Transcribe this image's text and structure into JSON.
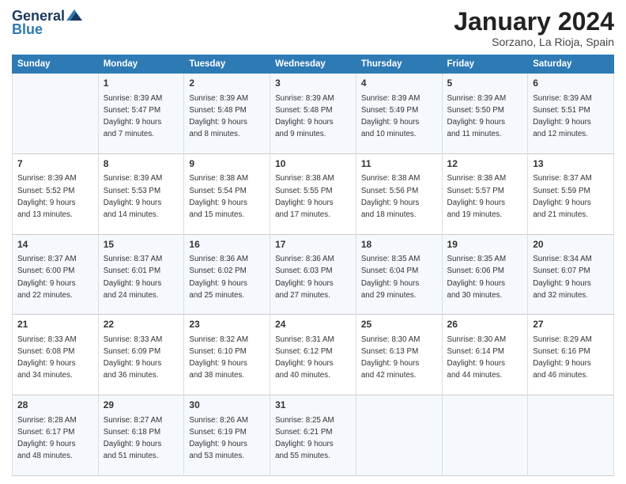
{
  "logo": {
    "line1": "General",
    "line2": "Blue"
  },
  "title": "January 2024",
  "subtitle": "Sorzano, La Rioja, Spain",
  "weekdays": [
    "Sunday",
    "Monday",
    "Tuesday",
    "Wednesday",
    "Thursday",
    "Friday",
    "Saturday"
  ],
  "weeks": [
    [
      {
        "day": null,
        "info": null
      },
      {
        "day": "1",
        "info": "Sunrise: 8:39 AM\nSunset: 5:47 PM\nDaylight: 9 hours\nand 7 minutes."
      },
      {
        "day": "2",
        "info": "Sunrise: 8:39 AM\nSunset: 5:48 PM\nDaylight: 9 hours\nand 8 minutes."
      },
      {
        "day": "3",
        "info": "Sunrise: 8:39 AM\nSunset: 5:48 PM\nDaylight: 9 hours\nand 9 minutes."
      },
      {
        "day": "4",
        "info": "Sunrise: 8:39 AM\nSunset: 5:49 PM\nDaylight: 9 hours\nand 10 minutes."
      },
      {
        "day": "5",
        "info": "Sunrise: 8:39 AM\nSunset: 5:50 PM\nDaylight: 9 hours\nand 11 minutes."
      },
      {
        "day": "6",
        "info": "Sunrise: 8:39 AM\nSunset: 5:51 PM\nDaylight: 9 hours\nand 12 minutes."
      }
    ],
    [
      {
        "day": "7",
        "info": "Sunrise: 8:39 AM\nSunset: 5:52 PM\nDaylight: 9 hours\nand 13 minutes."
      },
      {
        "day": "8",
        "info": "Sunrise: 8:39 AM\nSunset: 5:53 PM\nDaylight: 9 hours\nand 14 minutes."
      },
      {
        "day": "9",
        "info": "Sunrise: 8:38 AM\nSunset: 5:54 PM\nDaylight: 9 hours\nand 15 minutes."
      },
      {
        "day": "10",
        "info": "Sunrise: 8:38 AM\nSunset: 5:55 PM\nDaylight: 9 hours\nand 17 minutes."
      },
      {
        "day": "11",
        "info": "Sunrise: 8:38 AM\nSunset: 5:56 PM\nDaylight: 9 hours\nand 18 minutes."
      },
      {
        "day": "12",
        "info": "Sunrise: 8:38 AM\nSunset: 5:57 PM\nDaylight: 9 hours\nand 19 minutes."
      },
      {
        "day": "13",
        "info": "Sunrise: 8:37 AM\nSunset: 5:59 PM\nDaylight: 9 hours\nand 21 minutes."
      }
    ],
    [
      {
        "day": "14",
        "info": "Sunrise: 8:37 AM\nSunset: 6:00 PM\nDaylight: 9 hours\nand 22 minutes."
      },
      {
        "day": "15",
        "info": "Sunrise: 8:37 AM\nSunset: 6:01 PM\nDaylight: 9 hours\nand 24 minutes."
      },
      {
        "day": "16",
        "info": "Sunrise: 8:36 AM\nSunset: 6:02 PM\nDaylight: 9 hours\nand 25 minutes."
      },
      {
        "day": "17",
        "info": "Sunrise: 8:36 AM\nSunset: 6:03 PM\nDaylight: 9 hours\nand 27 minutes."
      },
      {
        "day": "18",
        "info": "Sunrise: 8:35 AM\nSunset: 6:04 PM\nDaylight: 9 hours\nand 29 minutes."
      },
      {
        "day": "19",
        "info": "Sunrise: 8:35 AM\nSunset: 6:06 PM\nDaylight: 9 hours\nand 30 minutes."
      },
      {
        "day": "20",
        "info": "Sunrise: 8:34 AM\nSunset: 6:07 PM\nDaylight: 9 hours\nand 32 minutes."
      }
    ],
    [
      {
        "day": "21",
        "info": "Sunrise: 8:33 AM\nSunset: 6:08 PM\nDaylight: 9 hours\nand 34 minutes."
      },
      {
        "day": "22",
        "info": "Sunrise: 8:33 AM\nSunset: 6:09 PM\nDaylight: 9 hours\nand 36 minutes."
      },
      {
        "day": "23",
        "info": "Sunrise: 8:32 AM\nSunset: 6:10 PM\nDaylight: 9 hours\nand 38 minutes."
      },
      {
        "day": "24",
        "info": "Sunrise: 8:31 AM\nSunset: 6:12 PM\nDaylight: 9 hours\nand 40 minutes."
      },
      {
        "day": "25",
        "info": "Sunrise: 8:30 AM\nSunset: 6:13 PM\nDaylight: 9 hours\nand 42 minutes."
      },
      {
        "day": "26",
        "info": "Sunrise: 8:30 AM\nSunset: 6:14 PM\nDaylight: 9 hours\nand 44 minutes."
      },
      {
        "day": "27",
        "info": "Sunrise: 8:29 AM\nSunset: 6:16 PM\nDaylight: 9 hours\nand 46 minutes."
      }
    ],
    [
      {
        "day": "28",
        "info": "Sunrise: 8:28 AM\nSunset: 6:17 PM\nDaylight: 9 hours\nand 48 minutes."
      },
      {
        "day": "29",
        "info": "Sunrise: 8:27 AM\nSunset: 6:18 PM\nDaylight: 9 hours\nand 51 minutes."
      },
      {
        "day": "30",
        "info": "Sunrise: 8:26 AM\nSunset: 6:19 PM\nDaylight: 9 hours\nand 53 minutes."
      },
      {
        "day": "31",
        "info": "Sunrise: 8:25 AM\nSunset: 6:21 PM\nDaylight: 9 hours\nand 55 minutes."
      },
      {
        "day": null,
        "info": null
      },
      {
        "day": null,
        "info": null
      },
      {
        "day": null,
        "info": null
      }
    ]
  ]
}
